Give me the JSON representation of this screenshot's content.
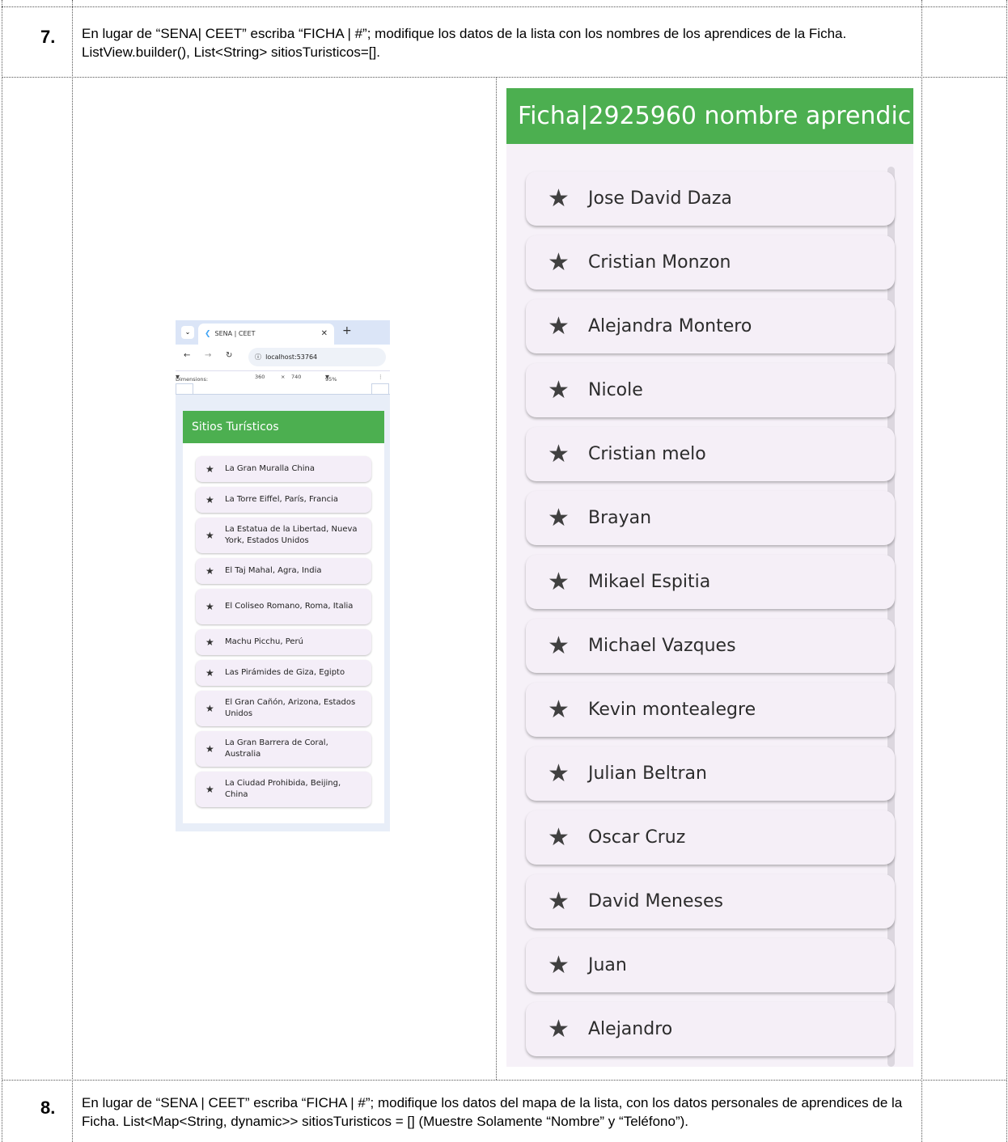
{
  "row7": {
    "number": "7.",
    "instruction": "En lugar de “SENA| CEET” escriba “FICHA | #”; modifique los datos de la lista con los nombres de los aprendices de la Ficha. ListView.builder(), List<String> sitiosTuristicos=[]."
  },
  "row8": {
    "number": "8.",
    "instruction": "En lugar de “SENA | CEET” escriba “FICHA | #”; modifique los datos del mapa de la lista, con los datos personales de aprendices de la Ficha. List<Map<String, dynamic>> sitiosTuristicos = [] (Muestre Solamente “Nombre” y “Teléfono”)."
  },
  "mini_browser": {
    "tab_title": "SENA | CEET",
    "url": "localhost:53764",
    "dimensions_label": "Dimensions: S...",
    "width": "360",
    "times": "×",
    "height": "740",
    "zoom": "95%",
    "app_title": "Sitios Turísticos",
    "items": [
      "La Gran Muralla China",
      "La Torre Eiffel, París, Francia",
      "La Estatua de la Libertad, Nueva York, Estados Unidos",
      "El Taj Mahal, Agra, India",
      "El Coliseo Romano, Roma, Italia",
      "Machu Picchu, Perú",
      "Las Pirámides de Giza, Egipto",
      "El Gran Cañón, Arizona, Estados Unidos",
      "La Gran Barrera de Coral, Australia",
      "La Ciudad Prohibida, Beijing, China"
    ]
  },
  "big_app": {
    "title": "Ficha|2925960 nombre aprendic...",
    "items": [
      "Jose David Daza",
      "Cristian Monzon",
      "Alejandra Montero",
      "Nicole",
      "Cristian melo",
      "Brayan",
      "Mikael Espitia",
      "Michael Vazques",
      "Kevin montealegre",
      "Julian Beltran",
      "Oscar Cruz",
      "David Meneses",
      "Juan",
      "Alejandro"
    ]
  },
  "icons": {
    "list_item_icon": "star-icon"
  },
  "colors": {
    "appbar": "#4caf50",
    "list_bg": "#f6f1f8"
  }
}
